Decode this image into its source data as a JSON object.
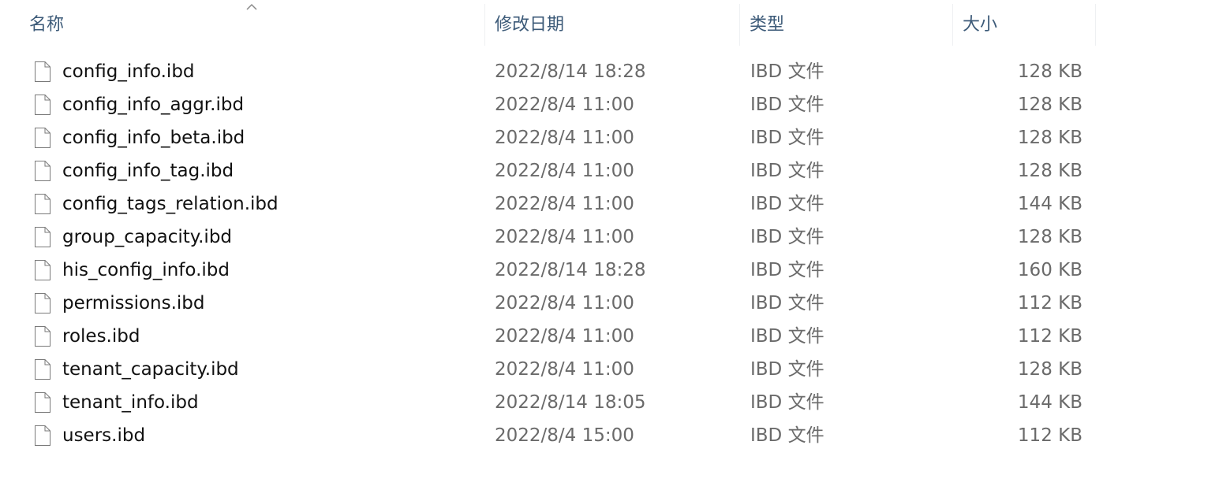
{
  "columns": {
    "name": "名称",
    "date": "修改日期",
    "type": "类型",
    "size": "大小"
  },
  "sort": {
    "column": "name",
    "icon": "sort-up-icon"
  },
  "files": [
    {
      "name": "config_info.ibd",
      "date": "2022/8/14 18:28",
      "type": "IBD 文件",
      "size": "128 KB"
    },
    {
      "name": "config_info_aggr.ibd",
      "date": "2022/8/4 11:00",
      "type": "IBD 文件",
      "size": "128 KB"
    },
    {
      "name": "config_info_beta.ibd",
      "date": "2022/8/4 11:00",
      "type": "IBD 文件",
      "size": "128 KB"
    },
    {
      "name": "config_info_tag.ibd",
      "date": "2022/8/4 11:00",
      "type": "IBD 文件",
      "size": "128 KB"
    },
    {
      "name": "config_tags_relation.ibd",
      "date": "2022/8/4 11:00",
      "type": "IBD 文件",
      "size": "144 KB"
    },
    {
      "name": "group_capacity.ibd",
      "date": "2022/8/4 11:00",
      "type": "IBD 文件",
      "size": "128 KB"
    },
    {
      "name": "his_config_info.ibd",
      "date": "2022/8/14 18:28",
      "type": "IBD 文件",
      "size": "160 KB"
    },
    {
      "name": "permissions.ibd",
      "date": "2022/8/4 11:00",
      "type": "IBD 文件",
      "size": "112 KB"
    },
    {
      "name": "roles.ibd",
      "date": "2022/8/4 11:00",
      "type": "IBD 文件",
      "size": "112 KB"
    },
    {
      "name": "tenant_capacity.ibd",
      "date": "2022/8/4 11:00",
      "type": "IBD 文件",
      "size": "128 KB"
    },
    {
      "name": "tenant_info.ibd",
      "date": "2022/8/14 18:05",
      "type": "IBD 文件",
      "size": "144 KB"
    },
    {
      "name": "users.ibd",
      "date": "2022/8/4 15:00",
      "type": "IBD 文件",
      "size": "112 KB"
    }
  ]
}
